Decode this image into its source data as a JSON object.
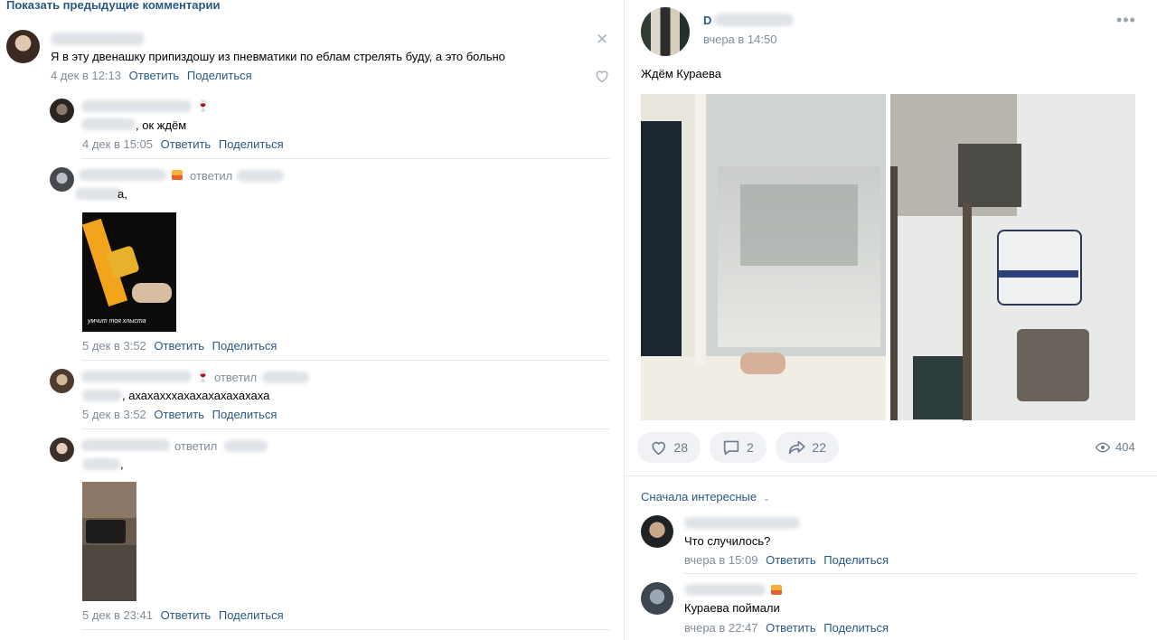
{
  "left": {
    "show_prev": "Показать предыдущие комментарии",
    "main_comment": {
      "text": "Я в эту двенашку припиздошу из пневматики по еблам стрелять буду, а это больно",
      "date": "4 дек в 12:13",
      "reply": "Ответить",
      "share": "Поделиться"
    },
    "replies": [
      {
        "text": ", ок ждём",
        "date": "4 дек в 15:05",
        "reply": "Ответить",
        "share": "Поделиться"
      },
      {
        "replied": "ответил",
        "text": "а,",
        "image_caption": "умчит тоя хлыста",
        "date": "5 дек в 3:52",
        "reply": "Ответить",
        "share": "Поделиться"
      },
      {
        "replied": "ответил",
        "text": ", ахахахххахахахахахахаха",
        "date": "5 дек в 3:52",
        "reply": "Ответить",
        "share": "Поделиться"
      },
      {
        "replied": "ответил",
        "text": ",",
        "date": "5 дек в 23:41",
        "reply": "Ответить",
        "share": "Поделиться"
      }
    ]
  },
  "post": {
    "author_initial": "D",
    "time": "вчера в 14:50",
    "text": "Ждём Кураева",
    "likes": "28",
    "comments": "2",
    "reposts": "22",
    "views": "404"
  },
  "comments": {
    "sort_label": "Сначала интересные",
    "items": [
      {
        "text": "Что случилось?",
        "date": "вчера в 15:09",
        "reply": "Ответить",
        "share": "Поделиться"
      },
      {
        "text": "Кураева поймали",
        "date": "вчера в 22:47",
        "reply": "Ответить",
        "share": "Поделиться"
      }
    ]
  },
  "colors": {
    "link": "#2a5885",
    "meta": "#818c99",
    "pill_bg": "#f0f2f5",
    "divider": "#e7e8ec"
  }
}
